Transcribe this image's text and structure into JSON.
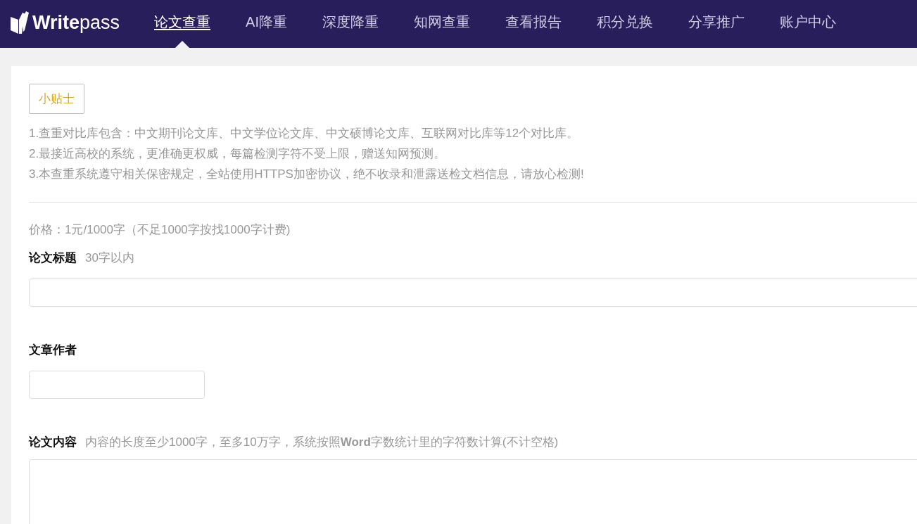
{
  "header": {
    "logo": "**Write**pass",
    "nav": [
      {
        "label": "论文查重",
        "selected": true
      },
      {
        "label": "AI降重",
        "selected": false
      },
      {
        "label": "深度降重",
        "selected": false
      },
      {
        "label": "知网查重",
        "selected": false
      },
      {
        "label": "查看报告",
        "selected": false
      },
      {
        "label": "积分兑换",
        "selected": false
      },
      {
        "label": "分享推广",
        "selected": false
      },
      {
        "label": "账户中心",
        "selected": false
      }
    ]
  },
  "tips": {
    "badge": "小贴士",
    "lines": [
      "1.查重对比库包含：中文期刊论文库、中文学位论文库、中文硕博论文库、互联网对比库等12个对比库。",
      "2.最接近高校的系统，更准确更权威，每篇检测字符不受上限，赠送知网预测。",
      "3.本查重系统遵守相关保密规定，全站使用HTTPS加密协议，绝不收录和泄露送检文档信息，请放心检测!"
    ]
  },
  "price": "价格：1元/1000字（不足1000字按找1000字计费)",
  "fields": [
    {
      "label": "论文标题",
      "hint": "30字以内",
      "kind": "wide"
    },
    {
      "label": "文章作者",
      "kind": "short"
    },
    {
      "label": "论文内容",
      "hint": "内容的长度至少1000字，至多10万字，系统按照**Word**字数统计里的字符数计算(不计空格)",
      "kind": "textarea"
    }
  ]
}
